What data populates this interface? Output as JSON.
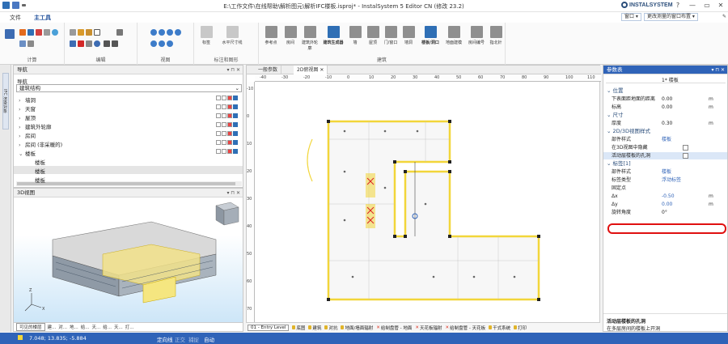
{
  "window": {
    "title": "E:\\工作文件\\在线帮助\\解析图元\\解析IFC楼板.isproj* - InstalSystem 5 Editor CN (修改 23.2)",
    "brand": "INSTALSYSTEM",
    "controls": [
      "?",
      "—",
      "▭",
      "✕"
    ]
  },
  "menu": {
    "tabs": [
      "文件",
      "主工具"
    ],
    "right_tools": [
      "窗口 ▾",
      "更改测量的窗口布置 ▾"
    ]
  },
  "ribbon": {
    "groups": [
      {
        "label": "计算"
      },
      {
        "label": "编辑"
      },
      {
        "label": "视图"
      },
      {
        "label": "标注和图形",
        "buttons": [
          "标签",
          "水平尺寸线"
        ]
      },
      {
        "label": "建筑",
        "buttons": [
          "参考点",
          "房间",
          "建筑外轮廓",
          "建筑生成器",
          "墙",
          "屋顶",
          "门/窗口",
          "墙洞",
          "楼板/洞口",
          "地面建模",
          "房间编号",
          "指北针"
        ]
      }
    ]
  },
  "left_strip": {
    "tab": "IFC 渲染对象"
  },
  "navigator": {
    "title": "导航",
    "subtitle": "导航",
    "dropdown": "建筑结构",
    "items": [
      {
        "label": "墙洞",
        "indent": 0,
        "expander": "›"
      },
      {
        "label": "天窗",
        "indent": 0,
        "expander": "›"
      },
      {
        "label": "屋顶",
        "indent": 0,
        "expander": "›"
      },
      {
        "label": "建筑外轮廓",
        "indent": 0,
        "expander": "›"
      },
      {
        "label": "房间",
        "indent": 0,
        "expander": "›"
      },
      {
        "label": "房间 (非采暖的)",
        "indent": 0,
        "expander": "›"
      },
      {
        "label": "楼板",
        "indent": 0,
        "expander": "⌄"
      },
      {
        "label": "楼板",
        "indent": 1,
        "expander": ""
      },
      {
        "label": "楼板",
        "indent": 1,
        "expander": "",
        "selected": true
      },
      {
        "label": "楼板",
        "indent": 1,
        "expander": ""
      }
    ]
  },
  "view3d": {
    "title": "3D视图",
    "status_items": [
      "可见的楼层",
      "建...",
      "对...",
      "地...",
      "给...",
      "天...",
      "给...",
      "天...",
      "打..."
    ]
  },
  "document": {
    "tabs": [
      "一般参数",
      "2D俯视图"
    ],
    "ruler_h": [
      "-40",
      "-30",
      "-20",
      "-10",
      "0",
      "10",
      "20",
      "30",
      "40",
      "50",
      "60",
      "70",
      "80",
      "90",
      "100",
      "110"
    ],
    "ruler_v": [
      "-10",
      "0",
      "10",
      "20",
      "30",
      "40",
      "50",
      "60",
      "70"
    ],
    "floor_select": "01 - Entry Level",
    "layers": [
      "底图",
      "建筑",
      "对抗",
      "地面/墙面辐射",
      "给制盘管 - 地面",
      "天花板辐射",
      "给制盘管 - 天花板",
      "干式系统",
      "打印"
    ]
  },
  "properties": {
    "title": "参数表",
    "header_value": "1* 楼板",
    "sections": [
      {
        "name": "位置",
        "rows": [
          {
            "key": "下表面距地面的距离",
            "value": "0.00",
            "unit": "m"
          },
          {
            "key": "标高",
            "value": "0.00",
            "unit": "m"
          }
        ]
      },
      {
        "name": "尺寸",
        "rows": [
          {
            "key": "厚度",
            "value": "0.30",
            "unit": "m"
          }
        ]
      },
      {
        "name": "2D/3D视图样式",
        "rows": [
          {
            "key": "部件样式",
            "value": "楼板",
            "unit": ""
          },
          {
            "key": "在3D视图中隐藏",
            "value": "",
            "unit": ""
          },
          {
            "key": "活动层楼板的孔洞",
            "value": "",
            "unit": ""
          }
        ]
      },
      {
        "name": "标签[1]",
        "rows": [
          {
            "key": "部件样式",
            "value": "楼板",
            "unit": ""
          },
          {
            "key": "标签类型",
            "value": "浮动标签",
            "unit": ""
          },
          {
            "key": "固定点",
            "value": "",
            "unit": ""
          },
          {
            "key": "Δx",
            "value": "-0.50",
            "unit": "m"
          },
          {
            "key": "Δy",
            "value": "0.00",
            "unit": "m"
          },
          {
            "key": "旋转角度",
            "value": "0°",
            "unit": ""
          }
        ]
      }
    ],
    "desc_title": "活动层楼板的孔洞",
    "desc_text": "在多层房间的楼板上开洞"
  },
  "statusbar": {
    "coords": "7.048; 13.835; -5.884",
    "modes": [
      "定向线",
      "正交",
      "捕捉",
      "自动"
    ]
  },
  "colors": {
    "accent": "#2f63b8",
    "highlight": "#ffe600",
    "plan_yellow": "#f2d63a",
    "callout_red": "#e01010"
  }
}
